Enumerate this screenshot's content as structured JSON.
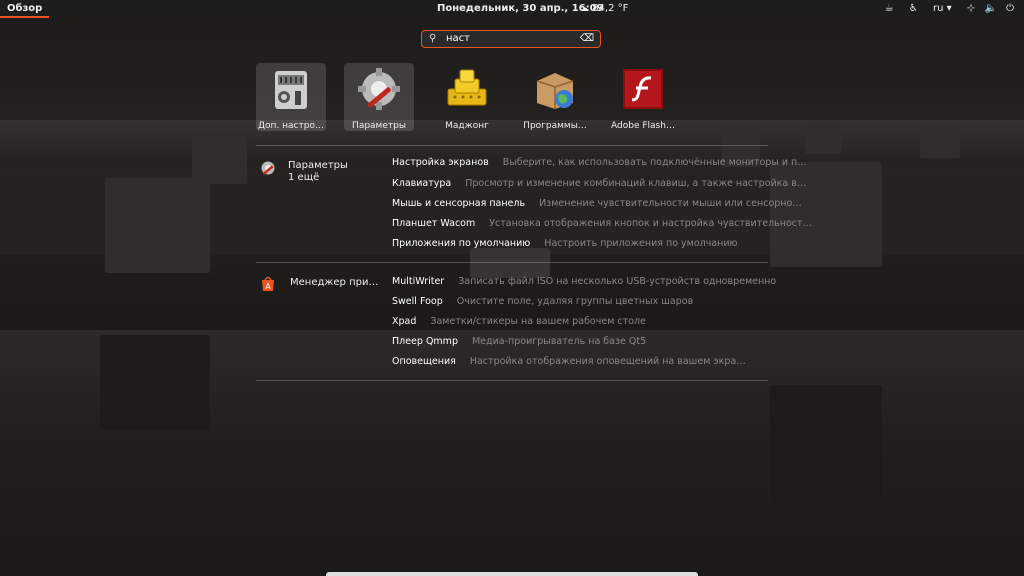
{
  "topbar": {
    "activities": "Обзор",
    "clock": "Понедельник, 30 апр., 16:09",
    "weather": "84,2 °F",
    "lang": "ru ▾"
  },
  "search": {
    "value": "наст"
  },
  "apps": [
    {
      "label": "Доп. настро…",
      "icon": "tweaks-icon"
    },
    {
      "label": "Параметры",
      "icon": "settings-icon"
    },
    {
      "label": "Маджонг",
      "icon": "mahjongg-icon"
    },
    {
      "label": "Программы…",
      "icon": "software-icon"
    },
    {
      "label": "Adobe Flash…",
      "icon": "flash-icon"
    }
  ],
  "providers": [
    {
      "name": "Параметры",
      "more": "1 ещё",
      "results": [
        {
          "title": "Настройка экранов",
          "desc": "Выберите, как использовать подключённые мониторы и п…"
        },
        {
          "title": "Клавиатура",
          "desc": "Просмотр и изменение комбинаций клавиш, а также настройка в…"
        },
        {
          "title": "Мышь и сенсорная панель",
          "desc": "Изменение чувствительности мыши или сенсорно…"
        },
        {
          "title": "Планшет Wacom",
          "desc": "Установка отображения кнопок и настройка чувствительност…"
        },
        {
          "title": "Приложения по умолчанию",
          "desc": "Настроить приложения по умолчанию"
        }
      ]
    },
    {
      "name": "Менеджер при…",
      "results": [
        {
          "title": "MultiWriter",
          "desc": "Записать файл ISO на несколько USB-устройств одновременно"
        },
        {
          "title": "Swell Foop",
          "desc": "Очистите поле, удаляя группы цветных шаров"
        },
        {
          "title": "Xpad",
          "desc": "Заметки/стикеры на вашем рабочем столе"
        },
        {
          "title": "Плеер Qmmp",
          "desc": "Медиа-проигрыватель на базе Qt5"
        },
        {
          "title": "Оповещения",
          "desc": "Настройка отображения оповещений на вашем экра…"
        }
      ]
    }
  ]
}
